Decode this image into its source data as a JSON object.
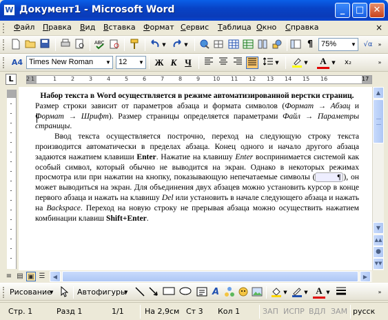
{
  "window": {
    "title": "Документ1 - Microsoft Word",
    "icon": "W",
    "minimize": "_",
    "maximize": "□",
    "close": "✕"
  },
  "menu": {
    "items": [
      "Файл",
      "Правка",
      "Вид",
      "Вставка",
      "Формат",
      "Сервис",
      "Таблица",
      "Окно",
      "Справка"
    ],
    "close": "×"
  },
  "standard_toolbar": {
    "zoom": "75%",
    "icons": [
      "new-document",
      "open",
      "save",
      "print",
      "print-preview",
      "spelling",
      "cut",
      "copy",
      "paste",
      "format-painter",
      "undo",
      "redo",
      "hyperlink",
      "tables-borders",
      "insert-table",
      "insert-excel",
      "columns",
      "drawing",
      "document-map",
      "show-hide",
      "zoom",
      "help"
    ]
  },
  "formatting_toolbar": {
    "style_icon": "A4",
    "font": "Times New Roman",
    "size": "12",
    "bold": "Ж",
    "italic": "К",
    "underline": "Ч",
    "font_color": "A",
    "subscript": "x₂"
  },
  "ruler": {
    "numbers": [
      "2",
      "1",
      "1",
      "2",
      "3",
      "4",
      "5",
      "6",
      "7",
      "8",
      "9",
      "10",
      "11",
      "12",
      "13",
      "14",
      "15",
      "16",
      "17"
    ]
  },
  "document": {
    "heading": "Набор текста в Word осуществляется в режиме автоматизированной верстки страниц.",
    "para1_parts": {
      "t1": "Размер строки зависит от параметров абзаца и формата символов (",
      "i1": "Формат → Абзац",
      "t2": " и ",
      "i2": "Формат → Шрифт",
      "t3": "). Размер страницы определяется параметрами ",
      "i3": "Файл → Параметры страницы",
      "t4": "."
    },
    "para2_parts": {
      "t1": "Ввод текста осуществляется построчно, переход на следующую строку текста производится автоматически в пределах абзаца. Конец одного и начало другого абзаца задаются нажатием клавиши ",
      "b1": "Enter",
      "t2": ". Нажатие на клавишу ",
      "i1": "Enter",
      "t3": " воспринимается системой как особый символ, который обычно не выводится на экран. Однако в некоторых режимах просмотра или при нажатии на кнопку, показывающую непечатаемые символы (",
      "mark": "¶",
      "t4": "), он может выводиться на экран. Для объединения двух абзацев можно установить курсор в конце первого абзаца и нажать на клавишу ",
      "i2": "Del",
      "t5": " или установить в начале следующего абзаца и нажать на ",
      "i3": "Backspace",
      "t6": ". Переход на новую строку не прерывая абзаца можно осуществить нажатием комбинации клавиш ",
      "b2": "Shift+Enter",
      "t7": "."
    }
  },
  "drawing_toolbar": {
    "draw_label": "Рисование",
    "autoshapes_label": "Автофигуры"
  },
  "status": {
    "page": "Стр. 1",
    "section": "Разд 1",
    "pages": "1/1",
    "at": "На 2,9см",
    "line": "Ст 3",
    "col": "Кол 1",
    "rec": "ЗАП",
    "trk": "ИСПР",
    "ext": "ВДЛ",
    "ovr": "ЗАМ",
    "lang": "русск"
  }
}
